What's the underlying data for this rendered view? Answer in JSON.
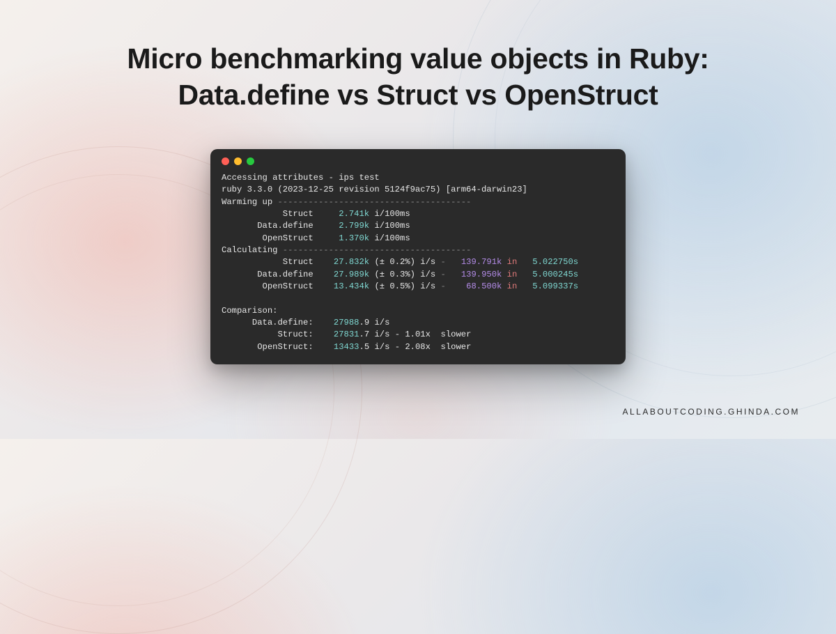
{
  "title_line1": "Micro benchmarking value objects in Ruby:",
  "title_line2": "Data.define vs Struct vs OpenStruct",
  "footer": "ALLABOUTCODING.GHINDA.COM",
  "terminal": {
    "header_line": "Accessing attributes - ips test",
    "ruby_line": "ruby 3.3.0 (2023-12-25 revision 5124f9ac75) [arm64-darwin23]",
    "warming_label": "Warming up",
    "dash_warm": " --------------------------------------",
    "warm_rows": [
      {
        "name": "Struct",
        "val": "2.741k",
        "unit": "i/100ms"
      },
      {
        "name": "Data.define",
        "val": "2.799k",
        "unit": "i/100ms"
      },
      {
        "name": "OpenStruct",
        "val": "1.370k",
        "unit": "i/100ms"
      }
    ],
    "calc_label": "Calculating",
    "dash_calc": " -------------------------------------",
    "calc_rows": [
      {
        "name": "Struct",
        "ips": "27.832k",
        "dev": "(± 0.2%)",
        "iters": "139.791k",
        "sec": "5.022750s"
      },
      {
        "name": "Data.define",
        "ips": "27.989k",
        "dev": "(± 0.3%)",
        "iters": "139.950k",
        "sec": "5.000245s"
      },
      {
        "name": "OpenStruct",
        "ips": "13.434k",
        "dev": "(± 0.5%)",
        "iters": "68.500k",
        "sec": "5.099337s"
      }
    ],
    "comparison_label": "Comparison:",
    "comp_rows": [
      {
        "name": "Data.define:",
        "ips_int": "27988",
        "ips_dec": ".9 i/s",
        "suffix": ""
      },
      {
        "name": "Struct:",
        "ips_int": "27831",
        "ips_dec": ".7 i/s - 1.01x  slower",
        "suffix": ""
      },
      {
        "name": "OpenStruct:",
        "ips_int": "13433",
        "ips_dec": ".5 i/s - 2.08x  slower",
        "suffix": ""
      }
    ],
    "ips_unit": "i/s",
    "dash_sep": "-",
    "in_word": "in"
  }
}
